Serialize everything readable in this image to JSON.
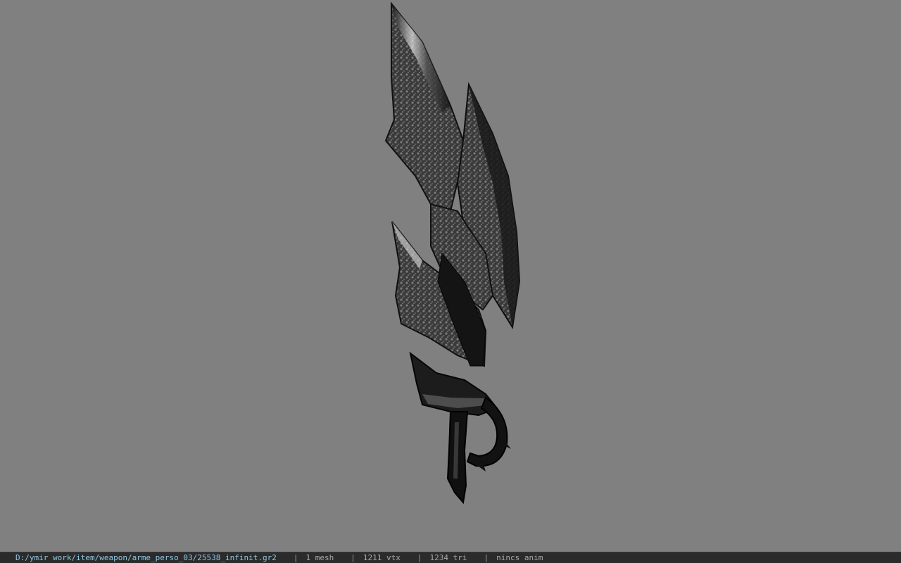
{
  "viewport": {
    "background": "#808080",
    "model_name": "sword-3d-model"
  },
  "status_bar": {
    "path": "D:/ymir work/item/weapon/arme_perso_03/25538_infinit.gr2",
    "separator": "|",
    "mesh": "1 mesh",
    "vertices": "1211 vtx",
    "triangles": "1234 tri",
    "animation": "nincs anim",
    "path_color": "#8fc7e8",
    "text_color": "#a8a8a8"
  }
}
